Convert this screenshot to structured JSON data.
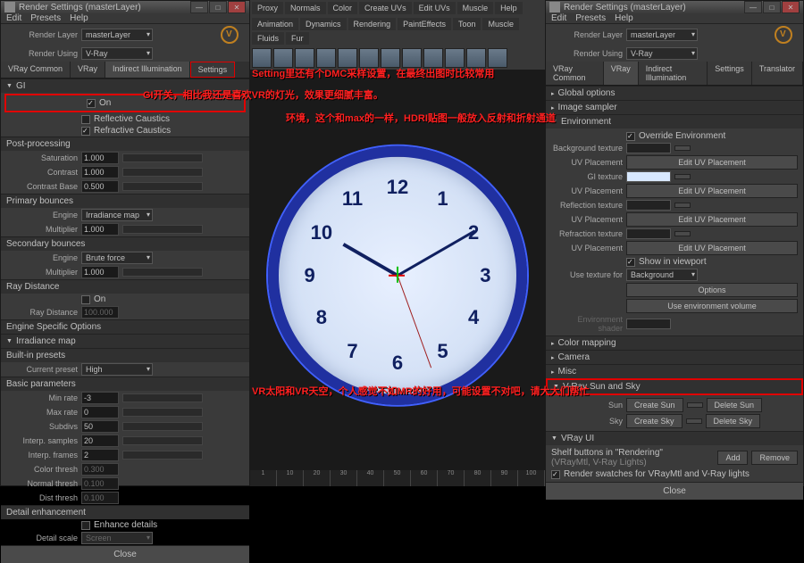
{
  "left": {
    "title": "Render Settings (masterLayer)",
    "menu": [
      "Edit",
      "Presets",
      "Help"
    ],
    "renderLayer": {
      "label": "Render Layer",
      "value": "masterLayer"
    },
    "renderUsing": {
      "label": "Render Using",
      "value": "V-Ray"
    },
    "tabs": [
      "VRay Common",
      "VRay",
      "Indirect Illumination",
      "Settings"
    ],
    "gi": {
      "header": "GI",
      "on_label": "On"
    },
    "reflCaustics": "Reflective Caustics",
    "refrCaustics": "Refractive Caustics",
    "postProcessing": {
      "header": "Post-processing",
      "saturation": {
        "label": "Saturation",
        "value": "1.000"
      },
      "contrast": {
        "label": "Contrast",
        "value": "1.000"
      },
      "contrastBase": {
        "label": "Contrast Base",
        "value": "0.500"
      }
    },
    "primary": {
      "header": "Primary bounces",
      "engine": {
        "label": "Engine",
        "value": "Irradiance map"
      },
      "multiplier": {
        "label": "Multiplier",
        "value": "1.000"
      }
    },
    "secondary": {
      "header": "Secondary bounces",
      "engine": {
        "label": "Engine",
        "value": "Brute force"
      },
      "multiplier": {
        "label": "Multiplier",
        "value": "1.000"
      }
    },
    "rayDist": {
      "header": "Ray Distance",
      "on": "On",
      "dist": {
        "label": "Ray Distance",
        "value": "100.000"
      }
    },
    "engineSpec": "Engine Specific Options",
    "irrMap": "Irradiance map",
    "builtin": {
      "header": "Built-in presets",
      "preset": {
        "label": "Current preset",
        "value": "High"
      }
    },
    "basic": {
      "header": "Basic parameters",
      "minRate": {
        "label": "Min rate",
        "value": "-3"
      },
      "maxRate": {
        "label": "Max rate",
        "value": "0"
      },
      "subdivs": {
        "label": "Subdivs",
        "value": "50"
      },
      "interpSamples": {
        "label": "Interp. samples",
        "value": "20"
      },
      "interpFrames": {
        "label": "Interp. frames",
        "value": "2"
      },
      "colorThresh": {
        "label": "Color thresh",
        "value": "0.300"
      },
      "normalThresh": {
        "label": "Normal thresh",
        "value": "0.100"
      },
      "distThresh": {
        "label": "Dist thresh",
        "value": "0.100"
      }
    },
    "detail": {
      "header": "Detail enhancement",
      "enhance": "Enhance details",
      "scale": {
        "label": "Detail scale",
        "value": "Screen"
      }
    },
    "close": "Close"
  },
  "center": {
    "shelfTabs": [
      "Proxy",
      "Normals",
      "Color",
      "Create UVs",
      "Edit UVs",
      "Muscle",
      "Help"
    ],
    "shelfTabs2": [
      "Animation",
      "Dynamics",
      "Rendering",
      "PaintEffects",
      "Toon",
      "Muscle",
      "Fluids",
      "Fur"
    ],
    "clockNums": [
      "12",
      "1",
      "2",
      "3",
      "4",
      "5",
      "6",
      "7",
      "8",
      "9",
      "10",
      "11"
    ],
    "timeline": [
      "1",
      "10",
      "20",
      "30",
      "40",
      "50",
      "60",
      "70",
      "80",
      "90",
      "100"
    ]
  },
  "right": {
    "title": "Render Settings (masterLayer)",
    "menu": [
      "Edit",
      "Presets",
      "Help"
    ],
    "renderLayer": {
      "label": "Render Layer",
      "value": "masterLayer"
    },
    "renderUsing": {
      "label": "Render Using",
      "value": "V-Ray"
    },
    "tabs": [
      "VRay Common",
      "VRay",
      "Indirect Illumination",
      "Settings",
      "Translator"
    ],
    "sections": {
      "globalOptions": "Global options",
      "imageSampler": "Image sampler",
      "environment": "Environment",
      "colorMapping": "Color mapping",
      "camera": "Camera",
      "misc": "Misc",
      "sunSky": "V-Ray Sun and Sky",
      "vrayUI": "VRay UI"
    },
    "env": {
      "override": "Override Environment",
      "bgTex": "Background texture",
      "uvPlace": "UV Placement",
      "editUV": "Edit UV Placement",
      "giTex": "GI texture",
      "reflTex": "Reflection texture",
      "refrTex": "Refraction texture",
      "showVP": "Show in viewport",
      "useTexFor": {
        "label": "Use texture for",
        "value": "Background"
      },
      "options": "Options",
      "useEnvVol": "Use environment volume",
      "envShader": "Environment shader"
    },
    "sun": {
      "sunLbl": "Sun",
      "createSun": "Create Sun",
      "deleteSun": "Delete Sun",
      "skyLbl": "Sky",
      "createSky": "Create Sky",
      "deleteSky": "Delete Sky"
    },
    "ui": {
      "shelf": "Shelf buttons in \"Rendering\"",
      "hint": "(VRayMtl, V-Ray Lights)",
      "add": "Add",
      "remove": "Remove",
      "swatches": "Render swatches for VRayMtl and V-Ray lights"
    },
    "close": "Close"
  },
  "annotations": {
    "a1": "Setting里还有个DMC采样设置，在最终出图时比较常用",
    "a2": "GI开关，相比我还是喜欢VR的灯光，效果更细腻丰富。",
    "a3": "环境，这个和max的一样，HDRI贴图一般放入反射和折射通道",
    "a4": "VR太阳和VR天空，个人感觉不如MR的好用，可能设置不对吧，请大大们帮忙"
  }
}
